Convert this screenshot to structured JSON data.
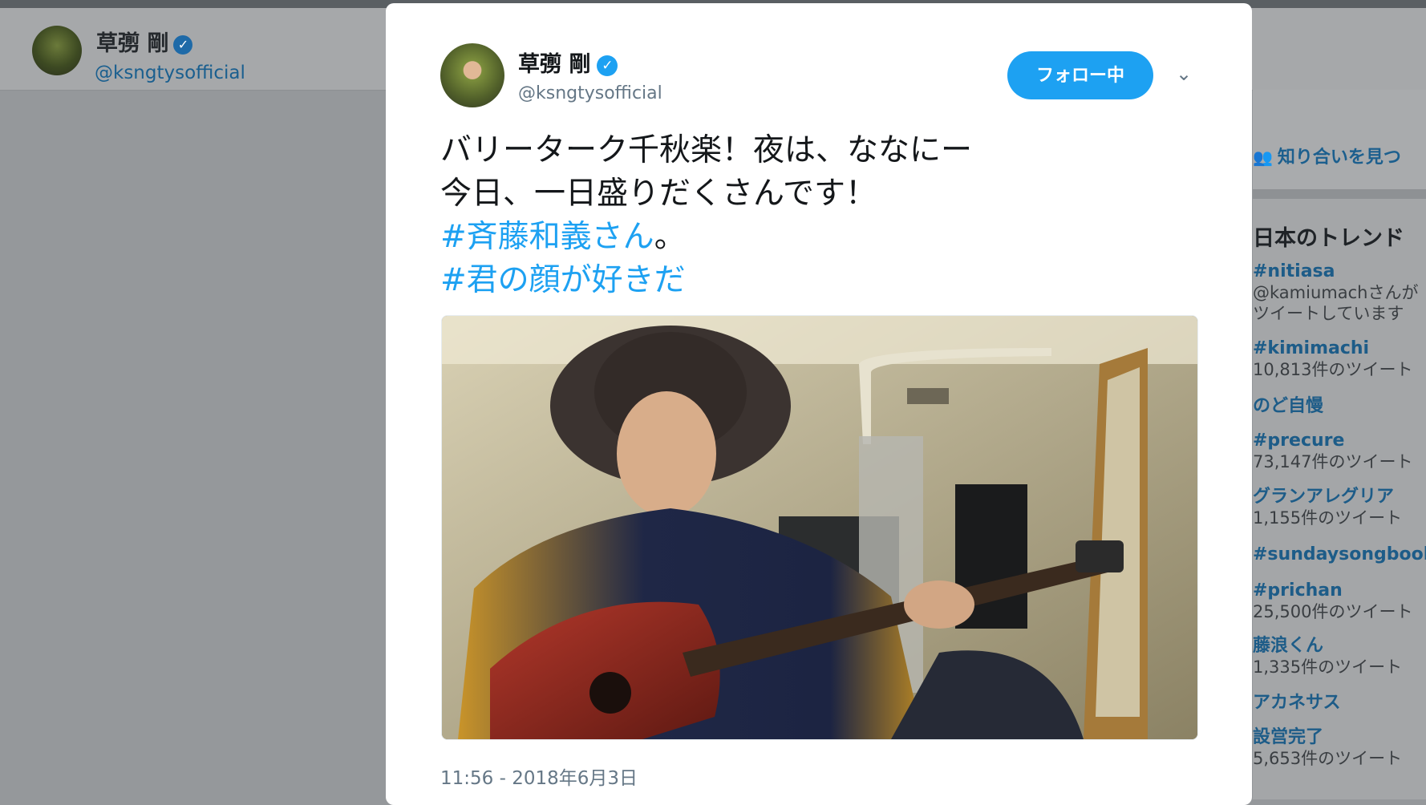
{
  "background": {
    "profile_name": "草彅 剛",
    "profile_handle": "@ksngtysofficial",
    "find_friends": "知り合いを見つ",
    "trends_title": "日本のトレンド",
    "trends": [
      {
        "tag": "#nitiasa",
        "sub": "@kamiumachさんが"
      },
      {
        "tag": "",
        "sub": "ツイートしています"
      },
      {
        "tag": "#kimimachi",
        "sub": "10,813件のツイート"
      },
      {
        "tag": "のど自慢",
        "sub": ""
      },
      {
        "tag": "#precure",
        "sub": "73,147件のツイート"
      },
      {
        "tag": "グランアレグリア",
        "sub": "1,155件のツイート"
      },
      {
        "tag": "#sundaysongbook",
        "sub": ""
      },
      {
        "tag": "#prichan",
        "sub": "25,500件のツイート"
      },
      {
        "tag": "藤浪くん",
        "sub": "1,335件のツイート"
      },
      {
        "tag": "アカネサス",
        "sub": ""
      },
      {
        "tag": "設営完了",
        "sub": "5,653件のツイート"
      }
    ]
  },
  "tweet": {
    "author_name": "草彅 剛",
    "author_handle": "@ksngtysofficial",
    "verified_glyph": "✓",
    "follow_label": "フォロー中",
    "menu_glyph": "⌄",
    "text_line1": "バリーターク千秋楽！夜は、ななにー",
    "text_line2": "今日、一日盛りだくさんです！",
    "hashtag1": "#斉藤和義さん",
    "hashtag1_suffix": "。",
    "hashtag2": "#君の顔が好きだ",
    "timestamp": "11:56 - 2018年6月3日"
  },
  "colors": {
    "accent": "#1da1f2",
    "overlay": "#95989b",
    "text": "#14171a",
    "muted": "#657786"
  }
}
